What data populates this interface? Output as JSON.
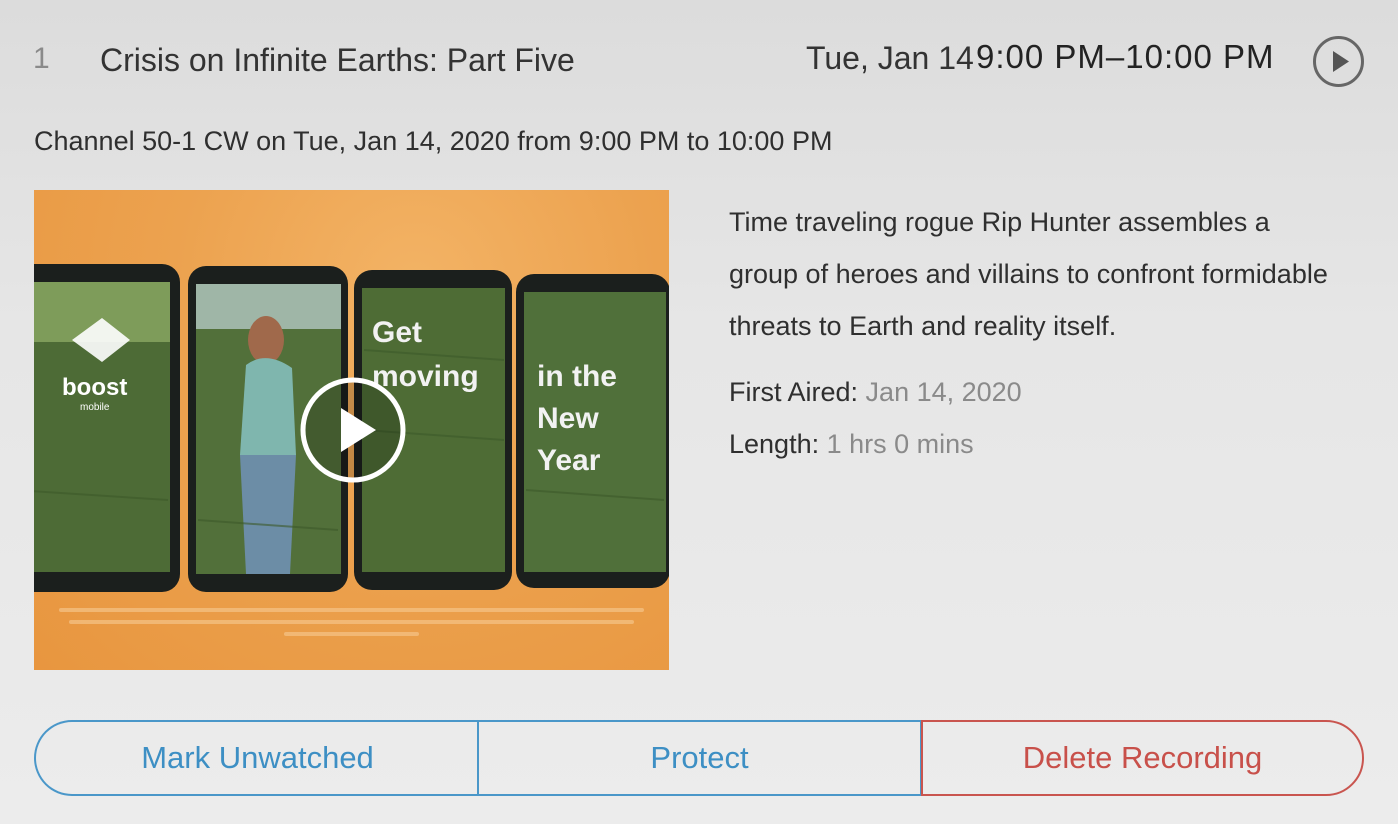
{
  "episode": {
    "number": "1",
    "title": "Crisis on Infinite Earths: Part Five",
    "air_date": "Tue, Jan 14",
    "air_time": "9:00 PM–10:00 PM",
    "play_icon": "play-circle-icon"
  },
  "channel_line": "Channel 50-1 CW on Tue, Jan 14, 2020 from 9:00 PM to 10:00 PM",
  "thumbnail": {
    "brand": "boost",
    "brand_sub": "mobile",
    "phone_text_1": "Get",
    "phone_text_2": "moving",
    "phone_text_3": "in the",
    "phone_text_4": "New",
    "phone_text_5": "Year",
    "play_icon": "play-icon"
  },
  "description": "Time traveling rogue Rip Hunter assembles a group of heroes and villains to confront formidable threats to Earth and reality itself.",
  "first_aired": {
    "label": "First Aired:",
    "value": "Jan 14, 2020"
  },
  "length": {
    "label": "Length:",
    "value": "1 hrs 0 mins"
  },
  "actions": {
    "mark_unwatched": "Mark Unwatched",
    "protect": "Protect",
    "delete": "Delete Recording"
  },
  "colors": {
    "accent_blue": "#3d8fc4",
    "danger_red": "#c8504a",
    "thumb_orange": "#eca24f"
  }
}
